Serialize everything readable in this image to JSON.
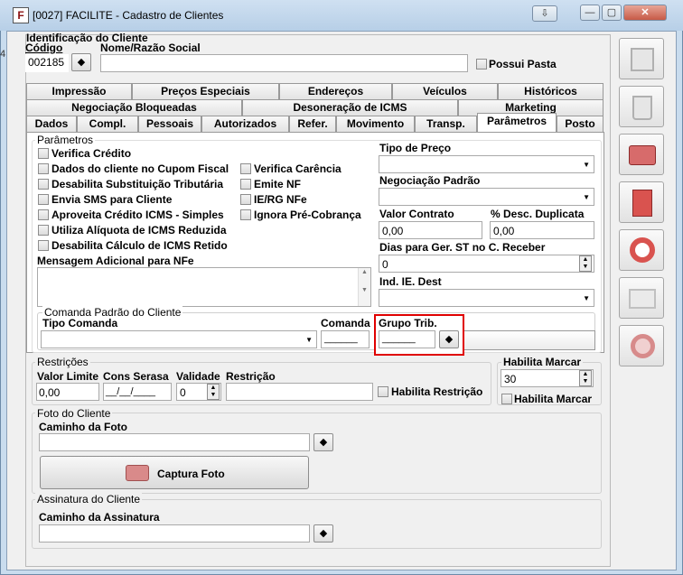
{
  "window": {
    "title": "[0027] FACILITE - Cadastro de Clientes",
    "icon_letter": "F"
  },
  "identificacao": {
    "group_title": "Identificação do Cliente",
    "codigo_label": "Código",
    "codigo_value": "002185",
    "nome_label": "Nome/Razão Social",
    "nome_value": "",
    "possui_pasta_label": "Possui Pasta"
  },
  "tabs": {
    "row1": [
      "Impressão",
      "Preços Especiais",
      "Endereços",
      "Veículos",
      "Históricos"
    ],
    "row2": [
      "Negociação Bloqueadas",
      "Desoneração de ICMS",
      "Marketing"
    ],
    "row3": [
      "Dados",
      "Compl.",
      "Pessoais",
      "Autorizados",
      "Refer.",
      "Movimento",
      "Transp.",
      "Parâmetros",
      "Posto"
    ],
    "active": "Parâmetros"
  },
  "parametros": {
    "group_title": "Parâmetros",
    "checks_left": [
      "Verifica Crédito",
      "Dados do cliente no Cupom Fiscal",
      "Desabilita Substituição Tributária",
      "Envia SMS para Cliente",
      "Aproveita Crédito ICMS - Simples",
      "Utiliza Alíquota de ICMS Reduzida",
      "Desabilita Cálculo de ICMS Retido"
    ],
    "checks_right": [
      "Verifica Carência",
      "Emite NF",
      "IE/RG NFe",
      "Ignora Pré-Cobrança"
    ],
    "mensagem_label": "Mensagem Adicional para NFe",
    "tipo_preco_label": "Tipo de Preço",
    "negociacao_label": "Negociação Padrão",
    "valor_contrato_label": "Valor Contrato",
    "valor_contrato_value": "0,00",
    "desc_dup_label": "% Desc. Duplicata",
    "desc_dup_value": "0,00",
    "dias_label": "Dias para Ger. ST no C. Receber",
    "dias_value": "0",
    "ind_ie_label": "Ind. IE. Dest"
  },
  "comanda": {
    "group_title": "Comanda Padrão do Cliente",
    "tipo_label": "Tipo Comanda",
    "comanda_label": "Comanda",
    "comanda_value": "______",
    "grupo_label": "Grupo Trib.",
    "grupo_value": "______"
  },
  "restricoes": {
    "group_title": "Restrições",
    "valor_limite_label": "Valor Limite",
    "valor_limite_value": "0,00",
    "serasa_label": "Cons Serasa",
    "serasa_value": "__/__/____",
    "validade_label": "Validade",
    "validade_value": "0",
    "restricao_label": "Restrição",
    "habilita_restricao_label": "Habilita Restrição"
  },
  "marcar": {
    "group_title": "Habilita Marcar",
    "value": "30",
    "check_label": "Habilita Marcar"
  },
  "foto": {
    "group_title": "Foto do Cliente",
    "caminho_label": "Caminho da Foto",
    "captura_label": "Captura Foto"
  },
  "assinatura": {
    "group_title": "Assinatura do Cliente",
    "caminho_label": "Caminho da Assinatura"
  },
  "side_buttons": [
    "save-icon",
    "trash-icon",
    "printer-icon",
    "exit-door-icon",
    "help-lifebuoy-icon",
    "id-card-icon",
    "settings-gear-icon"
  ],
  "colors": {
    "highlight": "#e00000",
    "title_bg": "#c9dcee"
  }
}
